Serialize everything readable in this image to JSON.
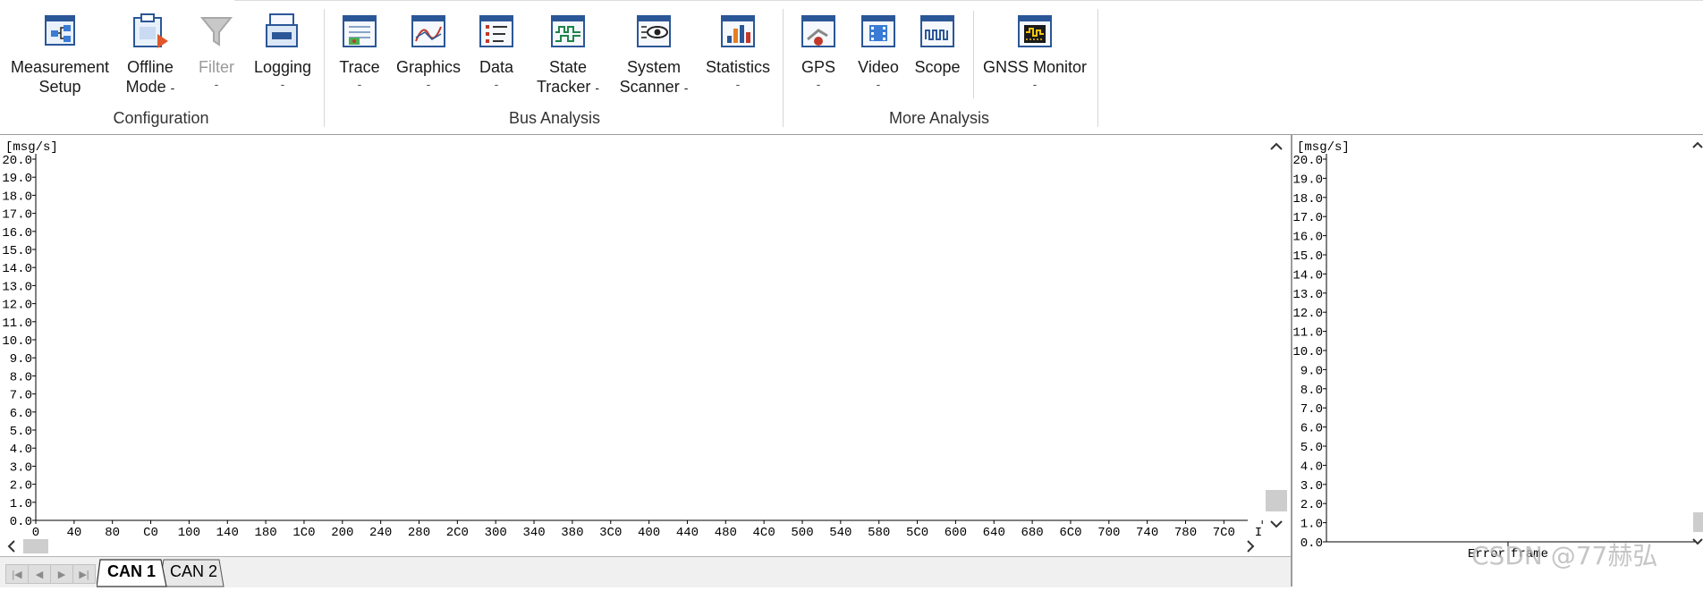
{
  "ribbon": {
    "groups": [
      {
        "label": "Configuration"
      },
      {
        "label": "Bus Analysis"
      },
      {
        "label": "More Analysis"
      }
    ],
    "buttons": [
      {
        "line1": "Measurement",
        "line2": "Setup",
        "dropdown": "",
        "icon": "measurement-setup-icon"
      },
      {
        "line1": "Offline",
        "line2": "Mode",
        "dropdown": "-",
        "icon": "offline-mode-icon"
      },
      {
        "line1": "Filter",
        "line2": "",
        "dropdown": "-",
        "icon": "filter-icon",
        "disabled": true
      },
      {
        "line1": "Logging",
        "line2": "",
        "dropdown": "-",
        "icon": "logging-icon"
      },
      {
        "line1": "Trace",
        "line2": "",
        "dropdown": "-",
        "icon": "trace-icon"
      },
      {
        "line1": "Graphics",
        "line2": "",
        "dropdown": "-",
        "icon": "graphics-icon"
      },
      {
        "line1": "Data",
        "line2": "",
        "dropdown": "-",
        "icon": "data-icon"
      },
      {
        "line1": "State",
        "line2": "Tracker",
        "dropdown": "-",
        "icon": "state-tracker-icon"
      },
      {
        "line1": "System",
        "line2": "Scanner",
        "dropdown": "-",
        "icon": "system-scanner-icon"
      },
      {
        "line1": "Statistics",
        "line2": "",
        "dropdown": "-",
        "icon": "statistics-icon"
      },
      {
        "line1": "GPS",
        "line2": "",
        "dropdown": "-",
        "icon": "gps-icon"
      },
      {
        "line1": "Video",
        "line2": "",
        "dropdown": "-",
        "icon": "video-icon"
      },
      {
        "line1": "Scope",
        "line2": "",
        "dropdown": "",
        "icon": "scope-icon"
      },
      {
        "line1": "GNSS Monitor",
        "line2": "",
        "dropdown": "-",
        "icon": "gnss-monitor-icon"
      }
    ]
  },
  "main_chart": {
    "unit": "[msg/s]",
    "y_ticks": [
      "20.0",
      "19.0",
      "18.0",
      "17.0",
      "16.0",
      "15.0",
      "14.0",
      "13.0",
      "12.0",
      "11.0",
      "10.0",
      "9.0",
      "8.0",
      "7.0",
      "6.0",
      "5.0",
      "4.0",
      "3.0",
      "2.0",
      "1.0",
      "0.0"
    ],
    "x_ticks": [
      "0",
      "40",
      "80",
      "C0",
      "100",
      "140",
      "180",
      "1C0",
      "200",
      "240",
      "280",
      "2C0",
      "300",
      "340",
      "380",
      "3C0",
      "400",
      "440",
      "480",
      "4C0",
      "500",
      "540",
      "580",
      "5C0",
      "600",
      "640",
      "680",
      "6C0",
      "700",
      "740",
      "780",
      "7C0",
      "ID"
    ]
  },
  "side_chart": {
    "unit": "[msg/s]",
    "y_ticks": [
      "20.0",
      "19.0",
      "18.0",
      "17.0",
      "16.0",
      "15.0",
      "14.0",
      "13.0",
      "12.0",
      "11.0",
      "10.0",
      "9.0",
      "8.0",
      "7.0",
      "6.0",
      "5.0",
      "4.0",
      "3.0",
      "2.0",
      "1.0",
      "0.0"
    ],
    "x_labels": [
      "Error",
      "frame"
    ]
  },
  "tabs": [
    {
      "label": "CAN 1",
      "active": true
    },
    {
      "label": "CAN 2",
      "active": false
    }
  ],
  "watermark": "CSDN @77赫弘",
  "colors": {
    "accent": "#c8102e",
    "icon_blue": "#2b5797"
  },
  "chart_data": [
    {
      "type": "bar",
      "title": "",
      "ylabel": "[msg/s]",
      "xlabel": "ID",
      "ylim": [
        0,
        20
      ],
      "categories": [
        "0",
        "40",
        "80",
        "C0",
        "100",
        "140",
        "180",
        "1C0",
        "200",
        "240",
        "280",
        "2C0",
        "300",
        "340",
        "380",
        "3C0",
        "400",
        "440",
        "480",
        "4C0",
        "500",
        "540",
        "580",
        "5C0",
        "600",
        "640",
        "680",
        "6C0",
        "700",
        "740",
        "780",
        "7C0"
      ],
      "values": [
        0,
        0,
        0,
        0,
        0,
        0,
        0,
        0,
        0,
        0,
        0,
        0,
        0,
        0,
        0,
        0,
        0,
        0,
        0,
        0,
        0,
        0,
        0,
        0,
        0,
        0,
        0,
        0,
        0,
        0,
        0,
        0
      ]
    },
    {
      "type": "bar",
      "title": "",
      "ylabel": "[msg/s]",
      "ylim": [
        0,
        20
      ],
      "categories": [
        "Error frame"
      ],
      "values": [
        0
      ]
    }
  ]
}
